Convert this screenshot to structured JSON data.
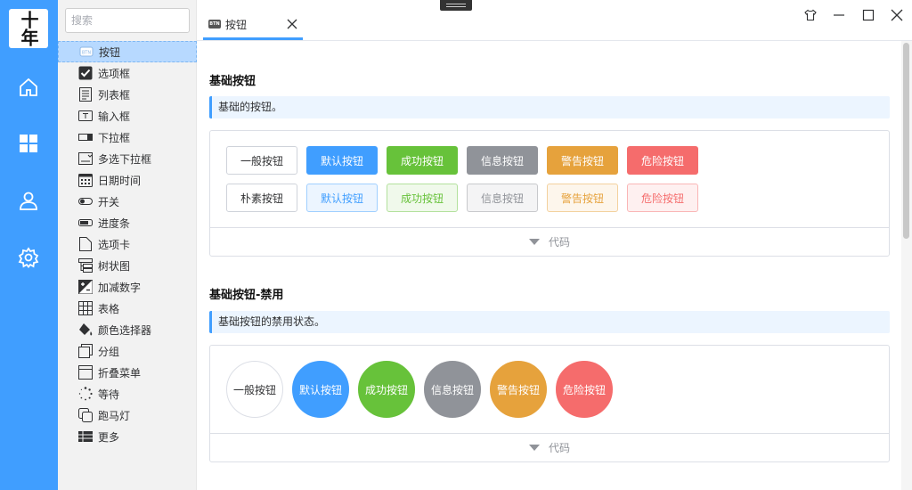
{
  "logo": {
    "text": "十年"
  },
  "rail": {
    "items": [
      {
        "icon": "home-icon"
      },
      {
        "icon": "grid-icon"
      },
      {
        "icon": "user-icon"
      },
      {
        "icon": "settings-icon"
      }
    ]
  },
  "sidebar": {
    "search_placeholder": "搜索",
    "items": [
      {
        "label": "按钮",
        "icon": "btn-icon"
      },
      {
        "label": "选项框",
        "icon": "checkbox-icon"
      },
      {
        "label": "列表框",
        "icon": "listbox-icon"
      },
      {
        "label": "输入框",
        "icon": "input-icon"
      },
      {
        "label": "下拉框",
        "icon": "dropdown-icon"
      },
      {
        "label": "多选下拉框",
        "icon": "multi-dropdown-icon"
      },
      {
        "label": "日期时间",
        "icon": "calendar-icon"
      },
      {
        "label": "开关",
        "icon": "switch-icon"
      },
      {
        "label": "进度条",
        "icon": "progress-icon"
      },
      {
        "label": "选项卡",
        "icon": "tab-icon"
      },
      {
        "label": "树状图",
        "icon": "tree-icon"
      },
      {
        "label": "加减数字",
        "icon": "plus-minus-icon"
      },
      {
        "label": "表格",
        "icon": "table-icon"
      },
      {
        "label": "颜色选择器",
        "icon": "paint-bucket-icon"
      },
      {
        "label": "分组",
        "icon": "group-icon"
      },
      {
        "label": "折叠菜单",
        "icon": "collapse-menu-icon"
      },
      {
        "label": "等待",
        "icon": "spinner-icon"
      },
      {
        "label": "跑马灯",
        "icon": "carousel-icon"
      },
      {
        "label": "更多",
        "icon": "more-icon"
      }
    ]
  },
  "tab": {
    "badge": "BTN",
    "label": "按钮"
  },
  "sections": {
    "basic": {
      "title": "基础按钮",
      "tip": "基础的按钮。",
      "row1": [
        "一般按钮",
        "默认按钮",
        "成功按钮",
        "信息按钮",
        "警告按钮",
        "危险按钮"
      ],
      "row2": [
        "朴素按钮",
        "默认按钮",
        "成功按钮",
        "信息按钮",
        "警告按钮",
        "危险按钮"
      ],
      "code_label": "代码"
    },
    "disabled": {
      "title": "基础按钮-禁用",
      "tip": "基础按钮的禁用状态。",
      "row1": [
        "一般按钮",
        "默认按钮",
        "成功按钮",
        "信息按钮",
        "警告按钮",
        "危险按钮"
      ],
      "code_label": "代码"
    }
  },
  "colors": {
    "primary": "#409eff",
    "success": "#67c23a",
    "info": "#909399",
    "warning": "#e6a23c",
    "danger": "#f56c6c"
  }
}
